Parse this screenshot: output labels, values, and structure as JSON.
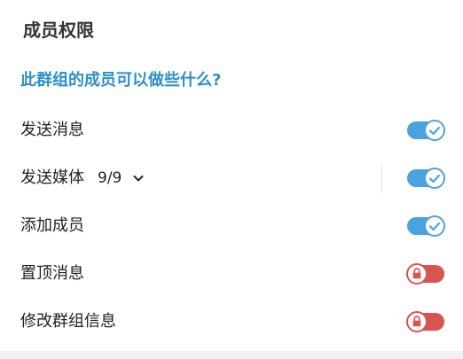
{
  "title": "成员权限",
  "section_title": "此群组的成员可以做些什么?",
  "colors": {
    "accent": "#4aa3df",
    "locked": "#d9534f",
    "section": "#2d8fcb"
  },
  "permissions": [
    {
      "label": "发送消息",
      "state": "on"
    },
    {
      "label": "发送媒体",
      "count": "9/9",
      "state": "on"
    },
    {
      "label": "添加成员",
      "state": "on"
    },
    {
      "label": "置顶消息",
      "state": "locked"
    },
    {
      "label": "修改群组信息",
      "state": "locked"
    }
  ]
}
